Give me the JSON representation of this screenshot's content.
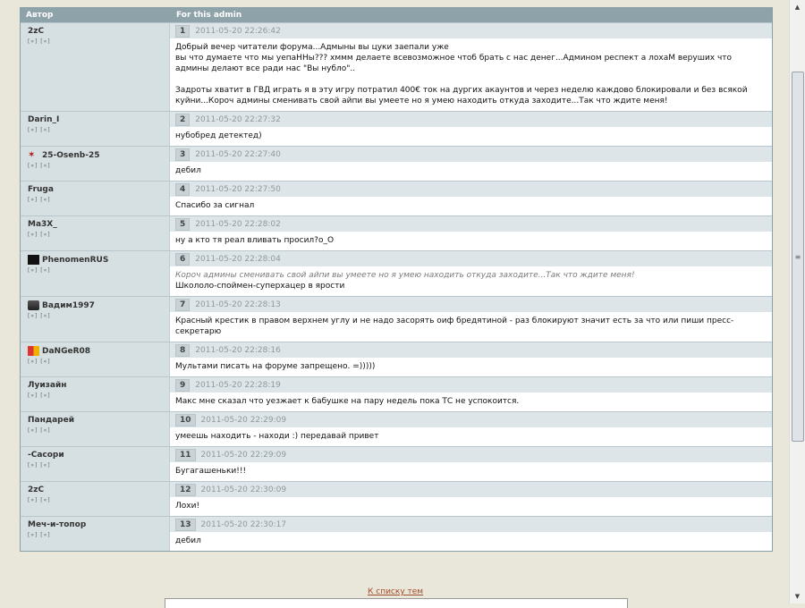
{
  "header": {
    "author_col": "Автор",
    "title_col": "For this admin"
  },
  "links_label": "[»] [«]",
  "posts": [
    {
      "author": "2zC",
      "num": "1",
      "date": "2011-05-20 22:26:42",
      "text": "Добрый вечер читатели форума...Адмыны вы цуки заепали уже\nвы что думаете что мы уепаННы??? хммм делаете всевозможное чтоб брать с нас денег...Админом респект а лохаМ веруших что\nадмины делают все ради нас \"Вы нубло\"..\n\nЗадроты хватит в ГВД играть я в эту игру потратил 400€ ток на дургих акаунтов и через неделю каждово блокировали и без всякой\nкуйни...Короч админы сменивать свой айпи вы умеете но я умею находить откуда заходите...Так что ждите меня!"
    },
    {
      "author": "Darin_I",
      "num": "2",
      "date": "2011-05-20 22:27:32",
      "text": "нубобред детектед)"
    },
    {
      "author": "25-Osenb-25",
      "num": "3",
      "date": "2011-05-20 22:27:40",
      "text": "дебил"
    },
    {
      "author": "Fruga",
      "num": "4",
      "date": "2011-05-20 22:27:50",
      "text": "Спасибо за сигнал"
    },
    {
      "author": "Ma3X_",
      "num": "5",
      "date": "2011-05-20 22:28:02",
      "text": "ну а кто тя реал вливать просил?о_О"
    },
    {
      "author": "PhenomenRUS",
      "num": "6",
      "date": "2011-05-20 22:28:04",
      "quote": "Короч админы сменивать свой айпи вы умеете но я умею находить откуда заходите...Так что ждите меня!",
      "text": "Школоло-споймен-суперхацер в ярости"
    },
    {
      "author": "Вадим1997",
      "num": "7",
      "date": "2011-05-20 22:28:13",
      "text": "Красный крестик в правом верхнем углу и не надо засорять оиф бредятиной - раз блокируют значит есть за что или пиши пресс-\nсекретарю"
    },
    {
      "author": "DaNGeR08",
      "num": "8",
      "date": "2011-05-20 22:28:16",
      "text": "Мультами писать на форуме запрещено. =)))))"
    },
    {
      "author": "Луизайн",
      "num": "9",
      "date": "2011-05-20 22:28:19",
      "text": "Макс мне сказал что уезжает к бабушке на пару недель пока ТС не успокоится."
    },
    {
      "author": "Пандарей",
      "num": "10",
      "date": "2011-05-20 22:29:09",
      "text": "умеешь находить - находи :) передавай привет"
    },
    {
      "author": "-Сасори",
      "num": "11",
      "date": "2011-05-20 22:29:09",
      "text": "Бугагашеньки!!!"
    },
    {
      "author": "2zC",
      "num": "12",
      "date": "2011-05-20 22:30:09",
      "text": "Лохи!"
    },
    {
      "author": "Меч-и-топор",
      "num": "13",
      "date": "2011-05-20 22:30:17",
      "text": "дебил"
    }
  ],
  "footer": {
    "back_link": "К списку тем"
  },
  "scrollbar": {
    "up": "▲",
    "down": "▼",
    "grip": "≡"
  },
  "icons": {
    "scorpion": "scorpion-icon",
    "black": "black-square-avatar",
    "tank": "tank-avatar",
    "flag": "flag-avatar"
  }
}
